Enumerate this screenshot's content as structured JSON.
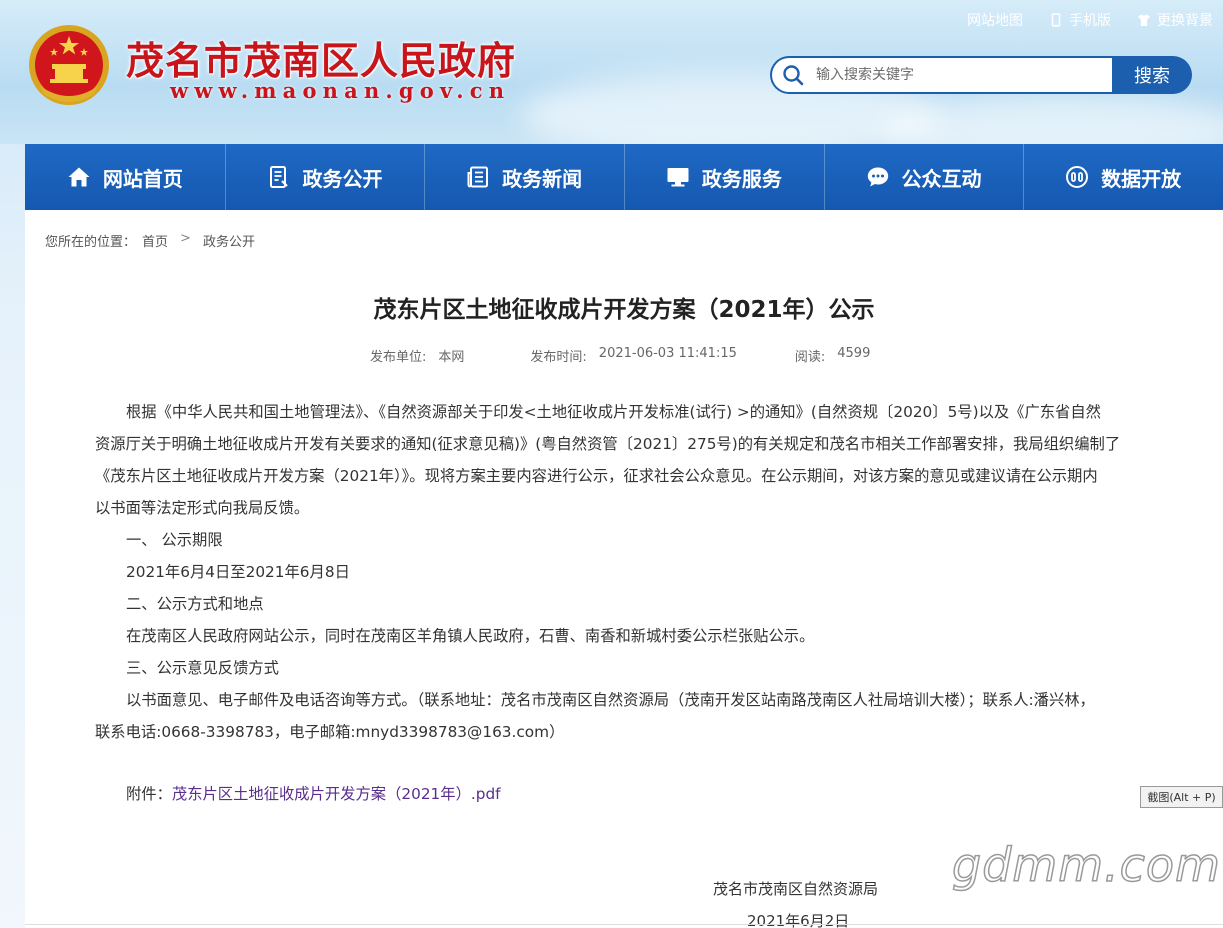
{
  "header": {
    "site_title": "茂名市茂南区人民政府",
    "site_url": "www.maonan.gov.cn",
    "top_links": [
      {
        "label": "网站地图",
        "icon": ""
      },
      {
        "label": "手机版",
        "icon": "mobile-icon"
      },
      {
        "label": "更换背景",
        "icon": "shirt-icon"
      }
    ],
    "search": {
      "placeholder": "输入搜索关键字",
      "button_label": "搜索",
      "icon": "search-icon"
    }
  },
  "nav": {
    "items": [
      {
        "label": "网站首页",
        "icon": "home-icon"
      },
      {
        "label": "政务公开",
        "icon": "document-icon"
      },
      {
        "label": "政务新闻",
        "icon": "news-icon"
      },
      {
        "label": "政务服务",
        "icon": "monitor-icon"
      },
      {
        "label": "公众互动",
        "icon": "chat-icon"
      },
      {
        "label": "数据开放",
        "icon": "data-icon"
      }
    ],
    "color": "#1b5fae"
  },
  "breadcrumb": {
    "prefix": "您所在的位置：",
    "items": [
      "首页",
      "政务公开"
    ],
    "separator": ">"
  },
  "article": {
    "title": "茂东片区土地征收成片开发方案（2021年）公示",
    "meta": {
      "publisher_label": "发布单位:",
      "publisher": "本网",
      "time_label": "发布时间:",
      "time": "2021-06-03 11:41:15",
      "views_label": "阅读:",
      "views": "4599"
    },
    "lines": [
      "根据《中华人民共和国土地管理法》、《自然资源部关于印发<土地征收成片开发标准(试行) >的通知》(自然资规〔2020〕5号)以及《广东省自然",
      "资源厅关于明确土地征收成片开发有关要求的通知(征求意见稿)》(粤自然资管〔2021〕275号)的有关规定和茂名市相关工作部署安排，我局组织编制了",
      "《茂东片区土地征收成片开发方案（2021年）》。现将方案主要内容进行公示，征求社会公众意见。在公示期间，对该方案的意见或建议请在公示期内",
      "以书面等法定形式向我局反馈。",
      "一、 公示期限",
      "2021年6月4日至2021年6月8日",
      "二、公示方式和地点",
      "在茂南区人民政府网站公示，同时在茂南区羊角镇人民政府，石曹、南香和新城村委公示栏张贴公示。",
      "三、公示意见反馈方式",
      "以书面意见、电子邮件及电话咨询等方式。（联系地址：茂名市茂南区自然资源局（茂南开发区站南路茂南区人社局培训大楼）；联系人:潘兴林，",
      "联系电话:0668-3398783，电子邮箱:mnyd3398783@163.com）"
    ],
    "attachment_label": "附件：",
    "attachment_link": "茂东片区土地征收成片开发方案（2021年）.pdf",
    "signer": "茂名市茂南区自然资源局",
    "sign_date": "2021年6月2日"
  },
  "overlay": {
    "screenshot_tip": "截图(Alt + P)",
    "watermark": "gdmm.com"
  },
  "colors": {
    "title_red": "#c8141b",
    "nav_blue": "#1b5fae",
    "link_purple": "#5a2e8c"
  }
}
